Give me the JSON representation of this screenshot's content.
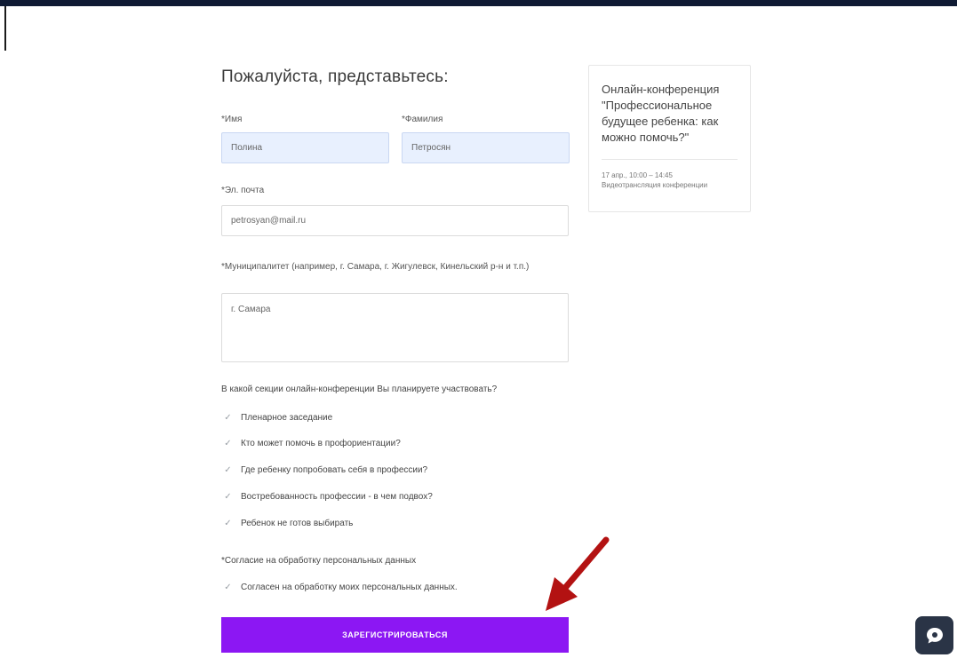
{
  "form": {
    "title": "Пожалуйста, представьтесь:",
    "first_name": {
      "label": "*Имя",
      "value": "Полина"
    },
    "last_name": {
      "label": "*Фамилия",
      "value": "Петросян"
    },
    "email": {
      "label": "*Эл. почта",
      "value": "petrosyan@mail.ru"
    },
    "municipality": {
      "label": "*Муниципалитет (например, г. Самара, г. Жигулевск, Кинельский р-н и т.п.)",
      "value": "г. Самара"
    },
    "sections_question": "В какой секции онлайн-конференции Вы планируете участвовать?",
    "sections": [
      {
        "label": "Пленарное заседание",
        "checked": true
      },
      {
        "label": "Кто может помочь в профориентации?",
        "checked": true
      },
      {
        "label": "Где ребенку попробовать себя в профессии?",
        "checked": true
      },
      {
        "label": "Востребованность профессии - в чем подвох?",
        "checked": true
      },
      {
        "label": "Ребенок не готов выбирать",
        "checked": true
      }
    ],
    "consent_title": "*Согласие на обработку персональных данных",
    "consent_label": "Согласен на обработку моих персональных данных.",
    "submit_label": "ЗАРЕГИСТРИРОВАТЬСЯ"
  },
  "card": {
    "title": "Онлайн-конференция \"Профессиональное будущее ребенка: как можно помочь?\"",
    "date": "17 апр., 10:00 – 14:45",
    "subtitle": "Видеотрансляция конференции"
  },
  "colors": {
    "accent": "#8c17f3",
    "topbar": "#0f1a33",
    "autofill": "#e8f0fe",
    "arrow": "#b31212",
    "chat": "#2a3446"
  },
  "icons": {
    "checkbox": "check-icon",
    "chat": "chat-icon",
    "annotation": "arrow-icon"
  }
}
